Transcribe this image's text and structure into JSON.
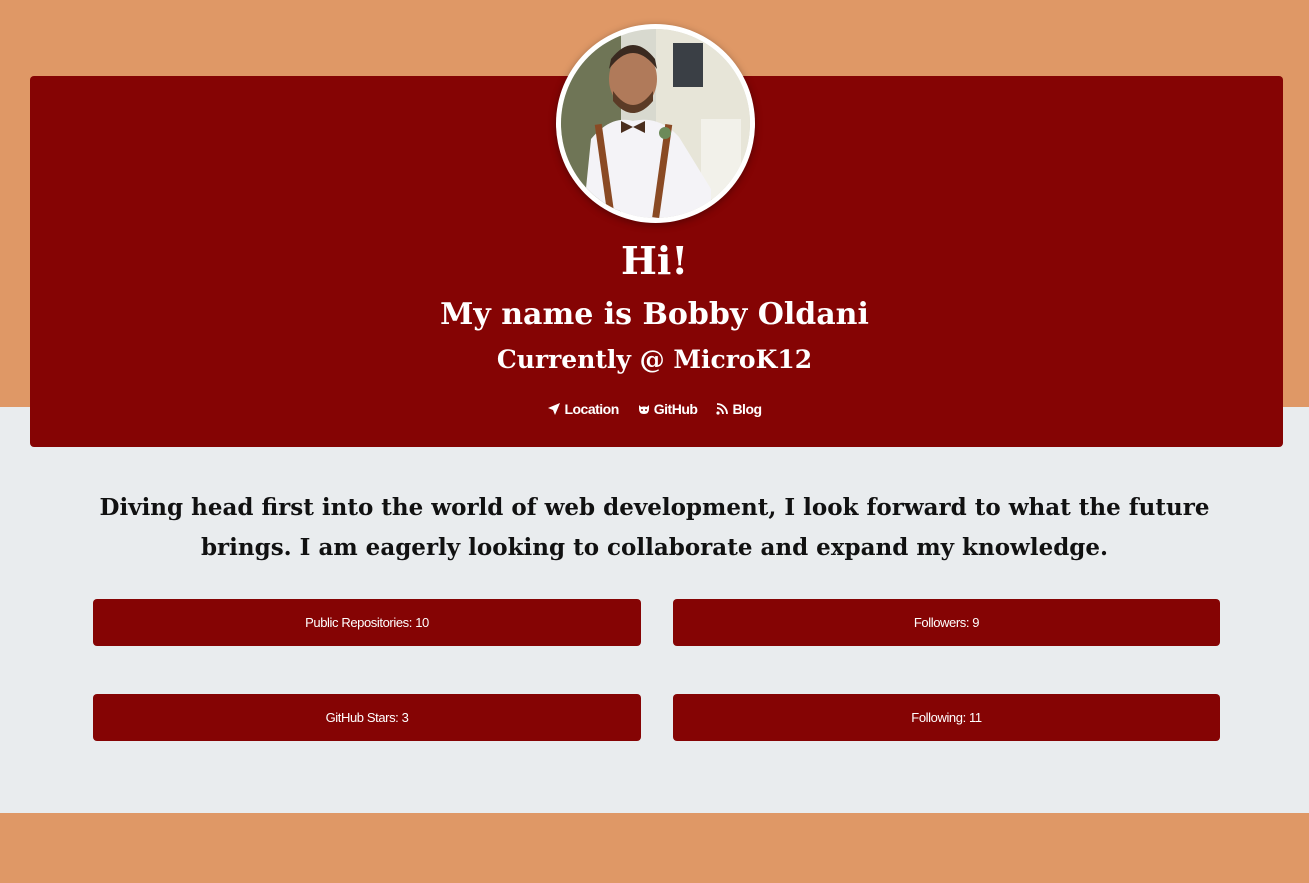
{
  "header": {
    "greeting": "Hi!",
    "name_line": "My name is Bobby Oldani",
    "company_line": "Currently @ MicroK12",
    "links": [
      {
        "label": "Location",
        "icon": "location-arrow-icon"
      },
      {
        "label": "GitHub",
        "icon": "github-icon"
      },
      {
        "label": "Blog",
        "icon": "rss-icon"
      }
    ]
  },
  "bio": {
    "line1": "Diving head first into the world of web development, I look forward to what the future",
    "line2": "brings. I am eagerly looking to collaborate and expand my knowledge."
  },
  "stats": {
    "repos": "Public Repositories: 10",
    "followers": "Followers: 9",
    "stars": "GitHub Stars: 3",
    "following": "Following: 11"
  },
  "colors": {
    "accent_band": "#df9866",
    "card": "#850404",
    "page_background": "#e9ecee",
    "text_light": "#ffffff"
  }
}
